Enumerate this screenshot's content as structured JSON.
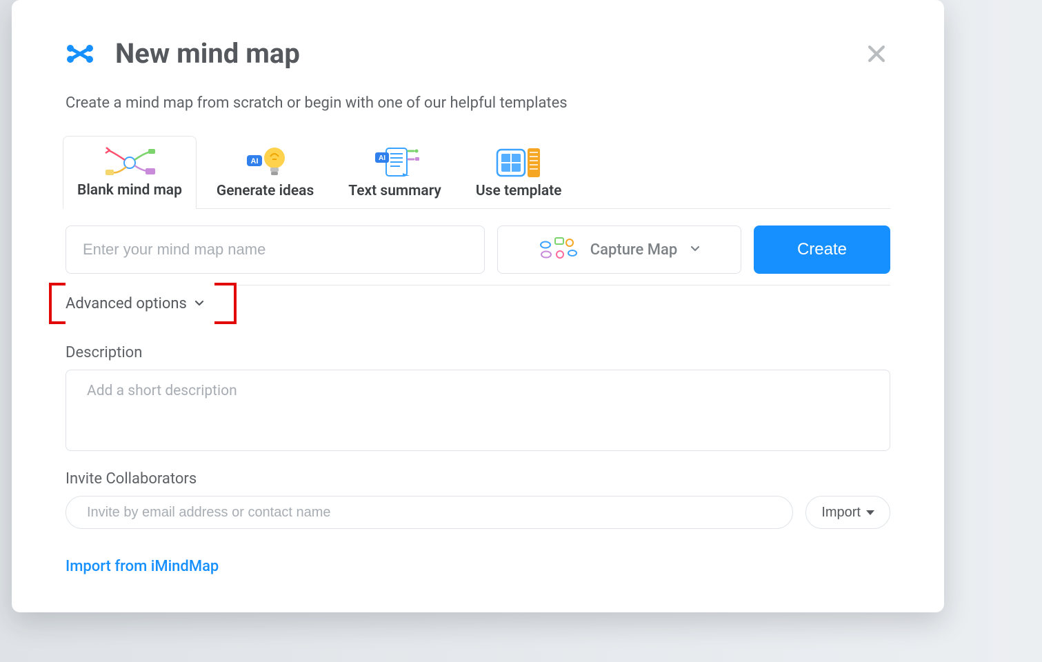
{
  "modal": {
    "title": "New mind map",
    "subtitle": "Create a mind map from scratch or begin with one of our helpful templates",
    "close_aria": "Close"
  },
  "tabs": [
    {
      "label": "Blank mind map"
    },
    {
      "label": "Generate ideas"
    },
    {
      "label": "Text summary"
    },
    {
      "label": "Use template"
    }
  ],
  "form": {
    "name_placeholder": "Enter your mind map name",
    "map_type_label": "Capture Map",
    "create_label": "Create",
    "advanced_label": "Advanced options",
    "description_label": "Description",
    "description_placeholder": "Add a short description",
    "invite_label": "Invite Collaborators",
    "invite_placeholder": "Invite by email address or contact name",
    "import_label": "Import",
    "imind_link": "Import from iMindMap"
  }
}
